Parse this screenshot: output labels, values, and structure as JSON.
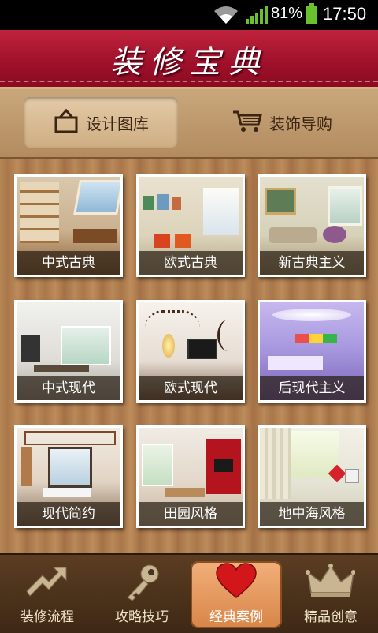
{
  "status": {
    "battery": "81%",
    "time": "17:50"
  },
  "app": {
    "title": "装修宝典"
  },
  "tabs": [
    {
      "label": "设计图库",
      "icon": "house-icon",
      "active": true
    },
    {
      "label": "装饰导购",
      "icon": "cart-icon",
      "active": false
    }
  ],
  "styles": [
    {
      "label": "中式古典"
    },
    {
      "label": "欧式古典"
    },
    {
      "label": "新古典主义"
    },
    {
      "label": "中式现代"
    },
    {
      "label": "欧式现代"
    },
    {
      "label": "后现代主义"
    },
    {
      "label": "现代简约"
    },
    {
      "label": "田园风格"
    },
    {
      "label": "地中海风格"
    }
  ],
  "bottom_nav": [
    {
      "label": "装修流程",
      "icon": "trend-arrow-icon"
    },
    {
      "label": "攻略技巧",
      "icon": "key-icon"
    },
    {
      "label": "经典案例",
      "icon": "heart-icon",
      "selected": true
    },
    {
      "label": "精品创意",
      "icon": "crown-icon"
    }
  ],
  "colors": {
    "title_red": "#9e1029",
    "accent_orange": "#d88548",
    "wood": "#b68656"
  }
}
